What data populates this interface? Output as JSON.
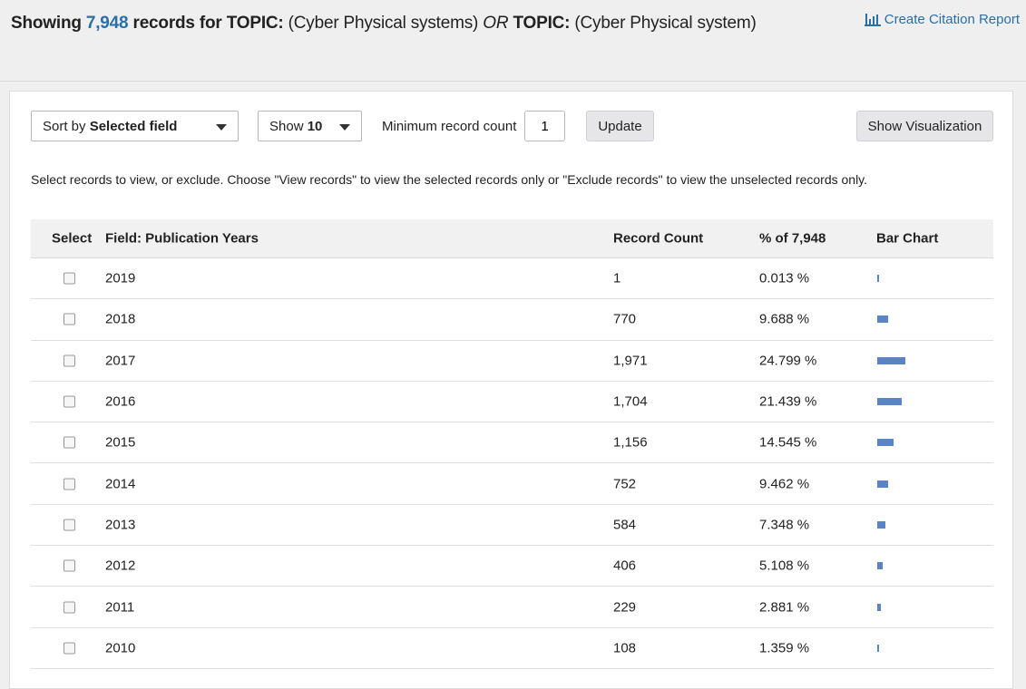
{
  "header": {
    "prefix": "Showing",
    "total": "7,948",
    "records_for": "records for",
    "topic1_label": "TOPIC:",
    "topic1_value": "(Cyber Physical systems)",
    "or_word": "OR",
    "topic2_label": "TOPIC:",
    "topic2_value": "(Cyber Physical system)",
    "citation_link": "Create Citation Report",
    "citation_icon": "bar-chart-icon"
  },
  "controls": {
    "sort_prefix": "Sort by",
    "sort_value": "Selected field",
    "show_prefix": "Show",
    "show_value": "10",
    "min_label": "Minimum record count",
    "min_value": "1",
    "update": "Update",
    "show_visualization": "Show Visualization"
  },
  "instructions": "Select records to view, or exclude. Choose \"View records\" to view the selected records only or \"Exclude records\" to view the unselected records only.",
  "table": {
    "headers": {
      "select": "Select",
      "field": "Field: Publication Years",
      "count": "Record Count",
      "pct": "% of 7,948",
      "bar": "Bar Chart"
    },
    "rows": [
      {
        "year": "2019",
        "count": "1",
        "pct": "0.013 %",
        "share": 0.013
      },
      {
        "year": "2018",
        "count": "770",
        "pct": "9.688 %",
        "share": 9.688
      },
      {
        "year": "2017",
        "count": "1,971",
        "pct": "24.799 %",
        "share": 24.799
      },
      {
        "year": "2016",
        "count": "1,704",
        "pct": "21.439 %",
        "share": 21.439
      },
      {
        "year": "2015",
        "count": "1,156",
        "pct": "14.545 %",
        "share": 14.545
      },
      {
        "year": "2014",
        "count": "752",
        "pct": "9.462 %",
        "share": 9.462
      },
      {
        "year": "2013",
        "count": "584",
        "pct": "7.348 %",
        "share": 7.348
      },
      {
        "year": "2012",
        "count": "406",
        "pct": "5.108 %",
        "share": 5.108
      },
      {
        "year": "2011",
        "count": "229",
        "pct": "2.881 %",
        "share": 2.881
      },
      {
        "year": "2010",
        "count": "108",
        "pct": "1.359 %",
        "share": 1.359
      }
    ]
  },
  "colors": {
    "link": "#2a6fa8",
    "bar": "#5b84c4"
  }
}
